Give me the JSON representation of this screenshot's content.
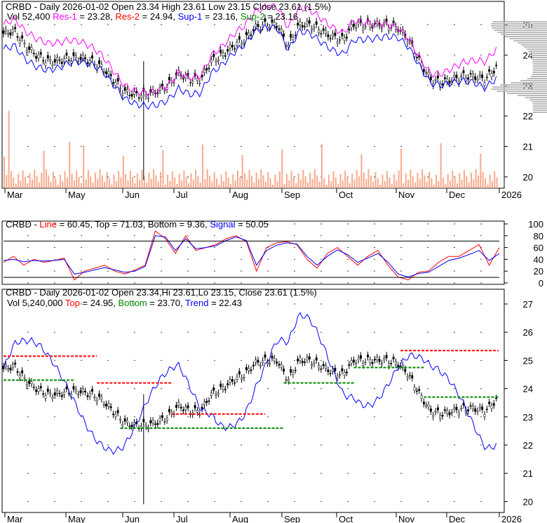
{
  "chart_data": [
    {
      "type": "candlestick",
      "title": "CRBD - Daily 2026-01-02 Open 23.34  High 23.61  Low 23.15  Close 23.61 (1.5%)",
      "legend": {
        "vol": "Vol 52,400",
        "res1": "Res-1",
        "res1_val": " = 23.28, ",
        "res2": "Res-2",
        "res2_val": " = 24.94, ",
        "sup1": "Sup-1",
        "sup1_val": " = 23.16, ",
        "sup2": "Sup-2",
        "sup2_val": " = 23.16"
      },
      "ylim": [
        19.7,
        25.6
      ],
      "yticks": [
        "25",
        "24",
        "23",
        "22",
        "21",
        "20"
      ],
      "closes": [
        24.7,
        24.8,
        24.3,
        24.0,
        23.8,
        23.8,
        23.9,
        23.9,
        23.8,
        23.6,
        23.2,
        22.8,
        22.7,
        22.7,
        22.8,
        23.0,
        23.4,
        23.2,
        23.2,
        23.8,
        24.0,
        24.3,
        24.5,
        24.9,
        25.0,
        25.0,
        24.3,
        25.0,
        25.0,
        24.8,
        24.6,
        24.5,
        25.0,
        25.0,
        25.0,
        25.0,
        24.9,
        24.5,
        23.8,
        23.2,
        23.1,
        23.2,
        23.3,
        23.3,
        23.2,
        23.6
      ]
    },
    {
      "type": "line",
      "title_prefix": "CRBD - ",
      "line_label": "Line",
      "line_val": " = 60.45, Top = 71.03, Bottom = 9.36, ",
      "signal_label": "Signal",
      "signal_val": " = 50.05",
      "ylim": [
        0,
        100
      ],
      "yticks": [
        "100",
        "80",
        "60",
        "40",
        "20",
        "0"
      ],
      "line": [
        35,
        45,
        30,
        40,
        35,
        38,
        42,
        5,
        20,
        25,
        30,
        20,
        15,
        22,
        30,
        88,
        75,
        50,
        80,
        55,
        60,
        65,
        75,
        80,
        70,
        20,
        60,
        68,
        70,
        65,
        40,
        25,
        50,
        60,
        45,
        30,
        45,
        55,
        30,
        10,
        5,
        18,
        20,
        35,
        45,
        45,
        55,
        65,
        30,
        60
      ],
      "signal": [
        38,
        40,
        36,
        38,
        37,
        38,
        40,
        15,
        18,
        22,
        26,
        22,
        18,
        20,
        28,
        80,
        78,
        55,
        75,
        58,
        60,
        63,
        72,
        78,
        72,
        30,
        55,
        64,
        68,
        66,
        45,
        30,
        45,
        56,
        48,
        35,
        42,
        50,
        35,
        15,
        10,
        16,
        18,
        28,
        38,
        42,
        48,
        55,
        38,
        50
      ]
    },
    {
      "type": "candlestick",
      "title": "CRBD - Daily 2026-01-02 Open 23.34,Hi 23.61,Lo 23.15, Close 23.61 (1.5%)",
      "legend": {
        "vol": "Vol 5,240,000 ",
        "top": "Top",
        "top_val": " = 24.95, ",
        "bottom": "Bottom",
        "bottom_val": " = 23.70, ",
        "trend": "Trend",
        "trend_val": " = 22.43"
      },
      "ylim": [
        19.8,
        27.3
      ],
      "yticks": [
        "27",
        "26",
        "25",
        "24",
        "23",
        "22",
        "21",
        "20"
      ]
    }
  ],
  "months": [
    "Mar",
    "May",
    "Jun",
    "Jul",
    "Aug",
    "Sep",
    "Oct",
    "Nov",
    "Dec",
    "2026"
  ]
}
